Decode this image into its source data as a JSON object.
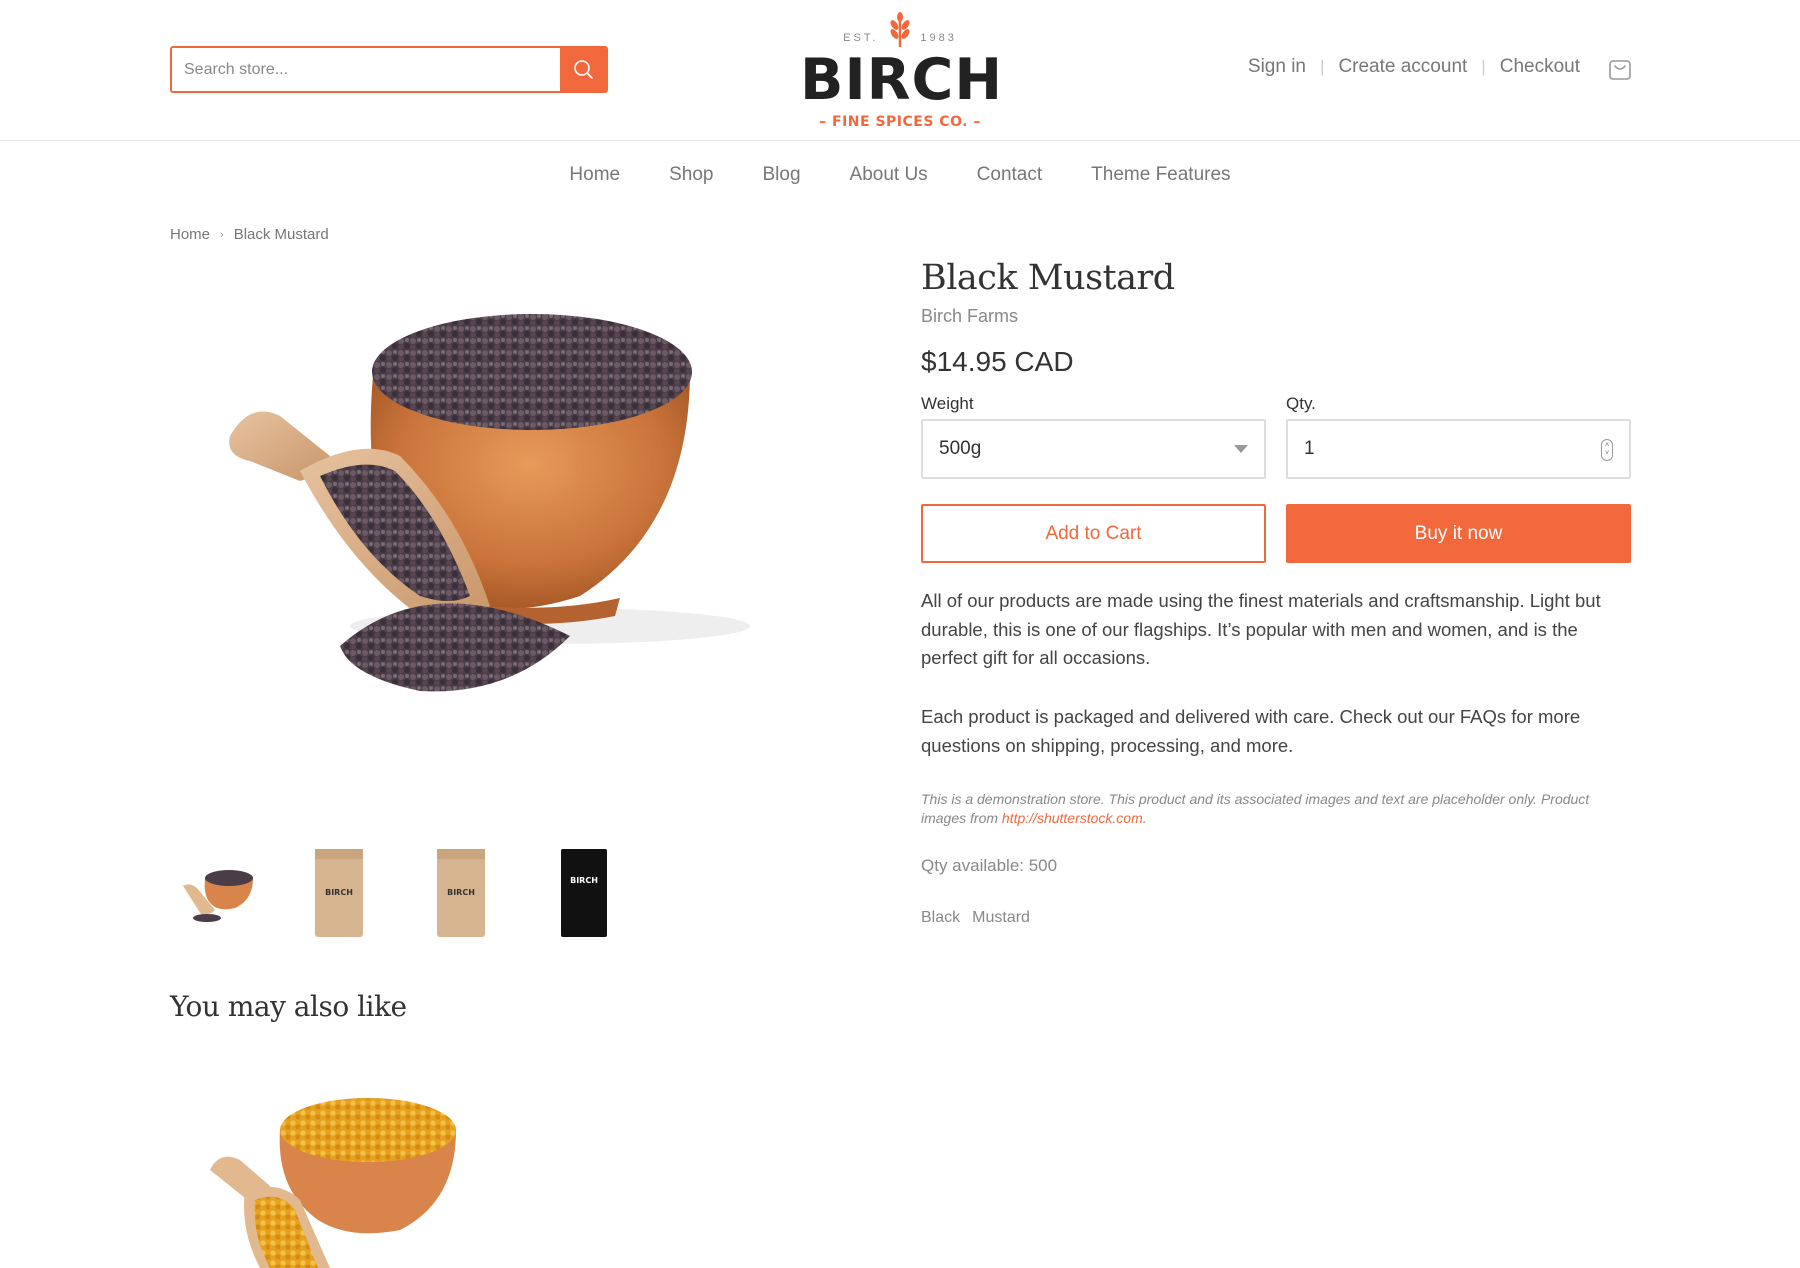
{
  "header": {
    "search_placeholder": "Search store...",
    "logo": {
      "est": "EST.",
      "year": "1983",
      "name": "BIRCH",
      "tagline": "– FINE SPICES CO. –"
    },
    "account_links": [
      "Sign in",
      "Create account",
      "Checkout"
    ]
  },
  "nav": [
    "Home",
    "Shop",
    "Blog",
    "About Us",
    "Contact",
    "Theme Features"
  ],
  "breadcrumb": {
    "home": "Home",
    "current": "Black Mustard"
  },
  "product": {
    "title": "Black Mustard",
    "vendor": "Birch Farms",
    "price": "$14.95 CAD",
    "weight_label": "Weight",
    "weight_value": "500g",
    "qty_label": "Qty.",
    "qty_value": "1",
    "add_to_cart": "Add to Cart",
    "buy_now": "Buy it now",
    "description_1": "All of our products are made using the finest materials and craftsmanship. Light but durable, this is one of our flagships. It’s popular with men and women, and is the perfect gift for all occasions.",
    "description_2": "Each product is packaged and delivered with care. Check out our FAQs for more questions on shipping, processing, and more.",
    "disclaimer_text": "This is a demonstration store. This product and its associated images and text are placeholder only. Product images from",
    "disclaimer_link": "http://shutterstock.com",
    "disclaimer_end": ".",
    "qty_available": "Qty available: 500",
    "tags": [
      "Black",
      "Mustard"
    ],
    "thumb_label": "BIRCH"
  },
  "recommendations": {
    "heading": "You may also like"
  },
  "colors": {
    "accent": "#f2683d",
    "text": "#333333",
    "muted": "#888888"
  }
}
